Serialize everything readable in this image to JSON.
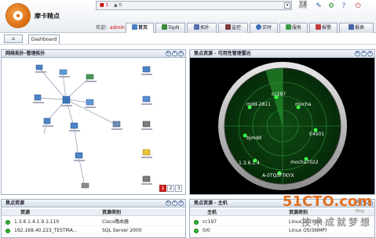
{
  "header": {
    "brand": "摩卡精点",
    "alarm": {
      "count1": "1",
      "count2": "0"
    },
    "welcome_prefix": "欢迎：",
    "username": "admin",
    "icons": [
      "quick-start-icon",
      "edit-icon",
      "config-icon",
      "help-icon",
      "exit-icon"
    ],
    "icon_labels": [
      "快速\n向导",
      "",
      "",
      "",
      ""
    ]
  },
  "nav": {
    "tabs": [
      {
        "label": "首页",
        "icon": "home-icon",
        "color": "#4a7fc1"
      },
      {
        "label": "TopN",
        "icon": "topn-icon",
        "color": "#3c8a3c"
      },
      {
        "label": "拓扑",
        "icon": "topology-icon",
        "color": "#5b6fb2"
      },
      {
        "label": "监控",
        "icon": "monitor-icon",
        "color": "#7a3c3c"
      },
      {
        "label": "实时",
        "icon": "realtime-icon",
        "color": "#3e6fb8"
      },
      {
        "label": "服务",
        "icon": "service-icon",
        "color": "#3d9a4a"
      },
      {
        "label": "报警",
        "icon": "alarm-icon",
        "color": "#c43a3a"
      },
      {
        "label": "报表",
        "icon": "report-icon",
        "color": "#4863a6"
      }
    ]
  },
  "tabbar": {
    "home_label": "⌂",
    "dashboard_label": "Dashboard"
  },
  "topology": {
    "title": "网络拓扑-管理拓扑",
    "pages": [
      "1",
      "2",
      "3"
    ],
    "current_page": "1"
  },
  "radar": {
    "title": "焦点资源 - 可用性管理雷达",
    "nodes": [
      "cc197",
      "mdd-2811",
      "mocha",
      "bjmdd",
      "E4501",
      "1.3.6.1.4",
      "mocha7022",
      "A-0TQ5FTKYX"
    ]
  },
  "table1": {
    "title": "焦点资源",
    "columns": [
      "资源",
      "资源类别"
    ],
    "rows": [
      {
        "name": "1.3.6.1.4.1.9.1.110",
        "type": "Cisco路由器"
      },
      {
        "name": "192.168.40.223_TESTMA...",
        "type": "SQL Server 2000"
      }
    ]
  },
  "table2": {
    "title": "焦点资源 - 主机",
    "columns": [
      "主机",
      "资源类别"
    ],
    "rows": [
      {
        "name": "cc197",
        "type": "Linux OS(SNM..."
      },
      {
        "name": "0/0",
        "type": "Linux OS(SNMP)"
      }
    ]
  },
  "watermark": {
    "top": "51CTO.com",
    "blog": "Blog",
    "bottom": "技术成就梦想"
  }
}
